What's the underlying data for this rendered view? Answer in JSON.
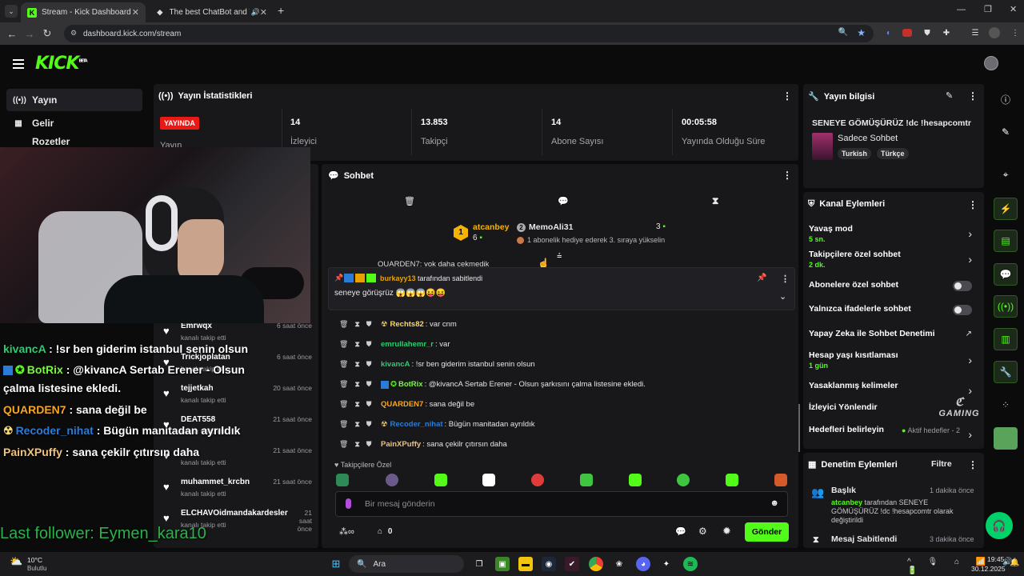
{
  "browser": {
    "tabs": [
      {
        "title": "Stream - Kick Dashboard"
      },
      {
        "title": "The best ChatBot and Widg"
      }
    ],
    "url": "dashboard.kick.com/stream"
  },
  "header": {
    "logo": "KICK",
    "beta": "BETA",
    "menu_icon": "hamburger-icon"
  },
  "sidebar": {
    "items": [
      {
        "label": "Yayın",
        "icon": "broadcast-icon"
      },
      {
        "label": "Gelir",
        "icon": "money-icon"
      },
      {
        "label": "Rozetler",
        "icon": "badge-icon"
      }
    ]
  },
  "stats": {
    "title": "Yayın İstatistikleri",
    "live_badge": "YAYINDA",
    "stream_label": "Yayın",
    "items": [
      {
        "value": "14",
        "label": "İzleyici"
      },
      {
        "value": "13.853",
        "label": "Takipçi"
      },
      {
        "value": "14",
        "label": "Abone Sayısı"
      },
      {
        "value": "00:05:58",
        "label": "Yayında Olduğu Süre"
      }
    ]
  },
  "activity_feed": [
    {
      "name": "Emrwqx",
      "sub": "kanalı takip etti",
      "time": "6 saat önce"
    },
    {
      "name": "Trickjoplatan",
      "sub": "kanalı takip etti",
      "time": "6 saat önce"
    },
    {
      "name": "tejjetkah",
      "sub": "kanalı takip etti",
      "time": "20 saat önce"
    },
    {
      "name": "DEAT558",
      "sub": "kanalı takip etti",
      "time": "21 saat önce"
    },
    {
      "name": "",
      "sub": "kanalı takip etti",
      "time": "21 saat önce"
    },
    {
      "name": "muhammet_krcbn",
      "sub": "kanalı takip etti",
      "time": "21 saat önce"
    },
    {
      "name": "ELCHAVOidmandakardesler",
      "sub": "kanalı takip etti",
      "time": "21 saat önce"
    }
  ],
  "overlay": {
    "lines": [
      {
        "user": "kivancA",
        "text": ": !sr ben giderim istanbul senin olsun",
        "color": "#2ecc71"
      },
      {
        "user": "BotRix",
        "text": ": @kivancA Sertab Erener - Olsun",
        "color": "#7ef542"
      },
      {
        "user": "",
        "text": "çalma listesine ekledi.",
        "color": "#ffffff"
      },
      {
        "user": "QUARDEN7",
        "text": ": sana değil be",
        "color": "#f5a623"
      },
      {
        "user": "Recoder_nihat",
        "text": ": Bügün manitadan ayrıldık",
        "color": "#2b7bd9"
      },
      {
        "user": "PainXPuffy",
        "text": ": sana çekilr çıtırsın daha",
        "color": "#f0c27b"
      }
    ],
    "last_follower": "Last follower: Eymen_kara10"
  },
  "chat": {
    "title": "Sohbet",
    "leaderboard": [
      {
        "name": "atcanbey",
        "count": "6",
        "rank": "1"
      },
      {
        "name": "MemoAli31",
        "count": "3",
        "rank": "2",
        "note": "1 abonelik hediye ederek 3. sıraya yükselin"
      }
    ],
    "partial_line": "QUARDEN7: yok daha çekmedik",
    "pinned": {
      "by": "burkayy13",
      "by_suffix": "tarafından sabitlendi",
      "text": "seneye görüşrüz 😱😱😱😝😝"
    },
    "messages": [
      {
        "user": "Rechts82",
        "text": ": var cnm",
        "color": "#f5d76e"
      },
      {
        "user": "emrullahemr_r",
        "text": ": var",
        "color": "#2ecc71"
      },
      {
        "user": "kivancA",
        "text": ": !sr ben giderim istanbul senin olsun",
        "color": "#2ecc71"
      },
      {
        "user": "BotRix",
        "text": ": @kivancA Sertab Erener - Olsun şarkısını çalma listesine ekledi.",
        "color": "#7ef542"
      },
      {
        "user": "QUARDEN7",
        "text": ": sana değil be",
        "color": "#f5a623"
      },
      {
        "user": "Recoder_nihat",
        "text": ": Bügün manitadan ayrıldık",
        "color": "#2b7bd9"
      },
      {
        "user": "PainXPuffy",
        "text": ": sana çekilr çıtırsın daha",
        "color": "#f0c27b"
      }
    ],
    "followers_only": "Takipçilere Özel",
    "input_placeholder": "Bir mesaj gönderin",
    "points": "0",
    "send_label": "Gönder"
  },
  "stream_info": {
    "title": "Yayın bilgisi",
    "stream_title": "SENEYE GÖMÜŞÜRÜZ !dc !hesapcomtr",
    "category": "Sadece Sohbet",
    "tags": [
      "Turkish",
      "Türkçe"
    ]
  },
  "channel_actions": {
    "title": "Kanal Eylemleri",
    "items": [
      {
        "label": "Yavaş mod",
        "value": "5 sn."
      },
      {
        "label": "Takipçilere özel sohbet",
        "value": "2 dk."
      },
      {
        "label": "Abonelere özel sohbet",
        "value": ""
      },
      {
        "label": "Yalnızca ifadelerle sohbet",
        "value": ""
      },
      {
        "label": "Yapay Zeka ile Sohbet Denetimi",
        "value": ""
      },
      {
        "label": "Hesap yaşı kısıtlaması",
        "value": "1 gün"
      },
      {
        "label": "Yasaklanmış kelimeler",
        "value": ""
      },
      {
        "label": "İzleyici Yönlendir",
        "value": ""
      },
      {
        "label": "Hedefleri belirleyin",
        "value": "Aktif hedefler - 2"
      }
    ]
  },
  "moderation": {
    "title": "Denetim Eylemleri",
    "filter": "Filtre",
    "items": [
      {
        "title": "Başlık",
        "time": "1 dakika önce",
        "actor": "atcanbey",
        "desc": "tarafından SENEYE GÖMÜŞÜRÜZ !dc !hesapcomtr olarak değiştirildi"
      },
      {
        "title": "Mesaj Sabitlendi",
        "time": "3 dakika önce"
      }
    ]
  },
  "watermark": "GAMING",
  "taskbar": {
    "weather_temp": "10°C",
    "weather_desc": "Bulutlu",
    "search": "Ara",
    "time": "19:45",
    "date": "30.12.2025"
  }
}
